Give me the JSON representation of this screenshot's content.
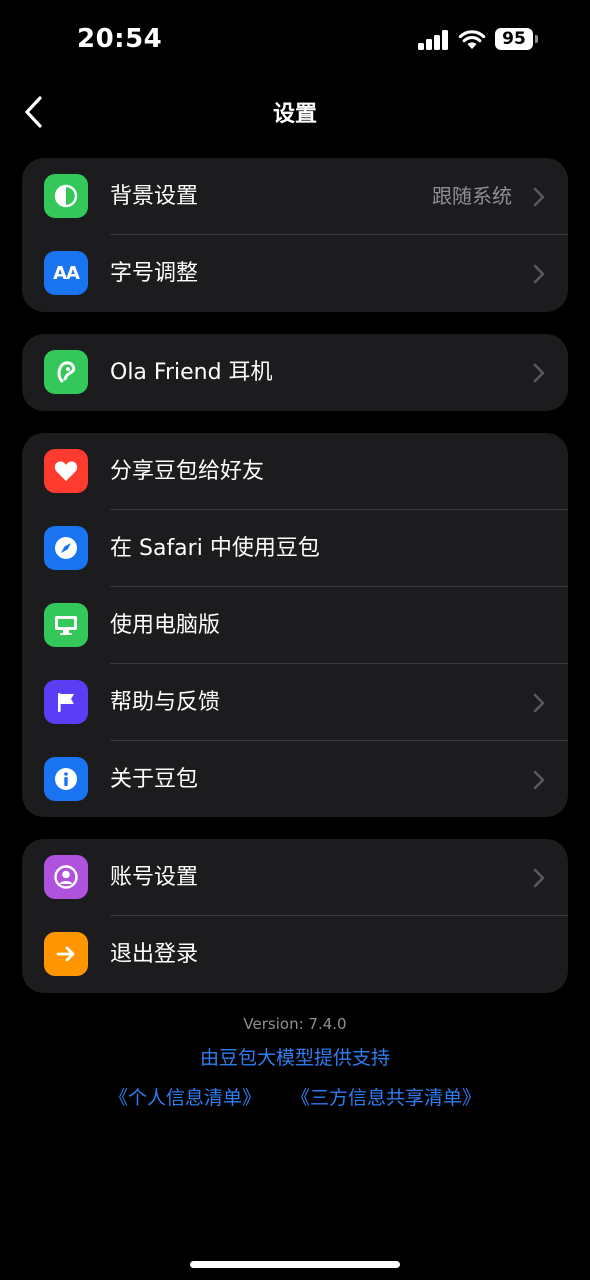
{
  "status_bar": {
    "time": "20:54",
    "battery": "95"
  },
  "nav": {
    "title": "设置"
  },
  "groups": {
    "appearance": {
      "background": {
        "label": "背景设置",
        "value": "跟随系统",
        "icon_color": "#34c759"
      },
      "font_size": {
        "label": "字号调整",
        "icon_text": "AA",
        "icon_color": "#1a73f0"
      }
    },
    "device": {
      "ola_friend": {
        "label": "Ola Friend 耳机",
        "icon_color": "#34c759"
      }
    },
    "general": {
      "share": {
        "label": "分享豆包给好友",
        "icon_color": "#ff3b30"
      },
      "safari": {
        "label": "在 Safari 中使用豆包",
        "icon_color": "#1a73f0"
      },
      "desktop": {
        "label": "使用电脑版",
        "icon_color": "#34c759"
      },
      "feedback": {
        "label": "帮助与反馈",
        "icon_color": "#5b3df5"
      },
      "about": {
        "label": "关于豆包",
        "icon_color": "#1a73f0"
      }
    },
    "account": {
      "settings": {
        "label": "账号设置",
        "icon_color": "#af52de"
      },
      "logout": {
        "label": "退出登录",
        "icon_color": "#ff9500"
      }
    }
  },
  "footer": {
    "version": "Version: 7.4.0",
    "support": "由豆包大模型提供支持",
    "personal_info_list": "《个人信息清单》",
    "third_party_list": "《三方信息共享清单》"
  }
}
